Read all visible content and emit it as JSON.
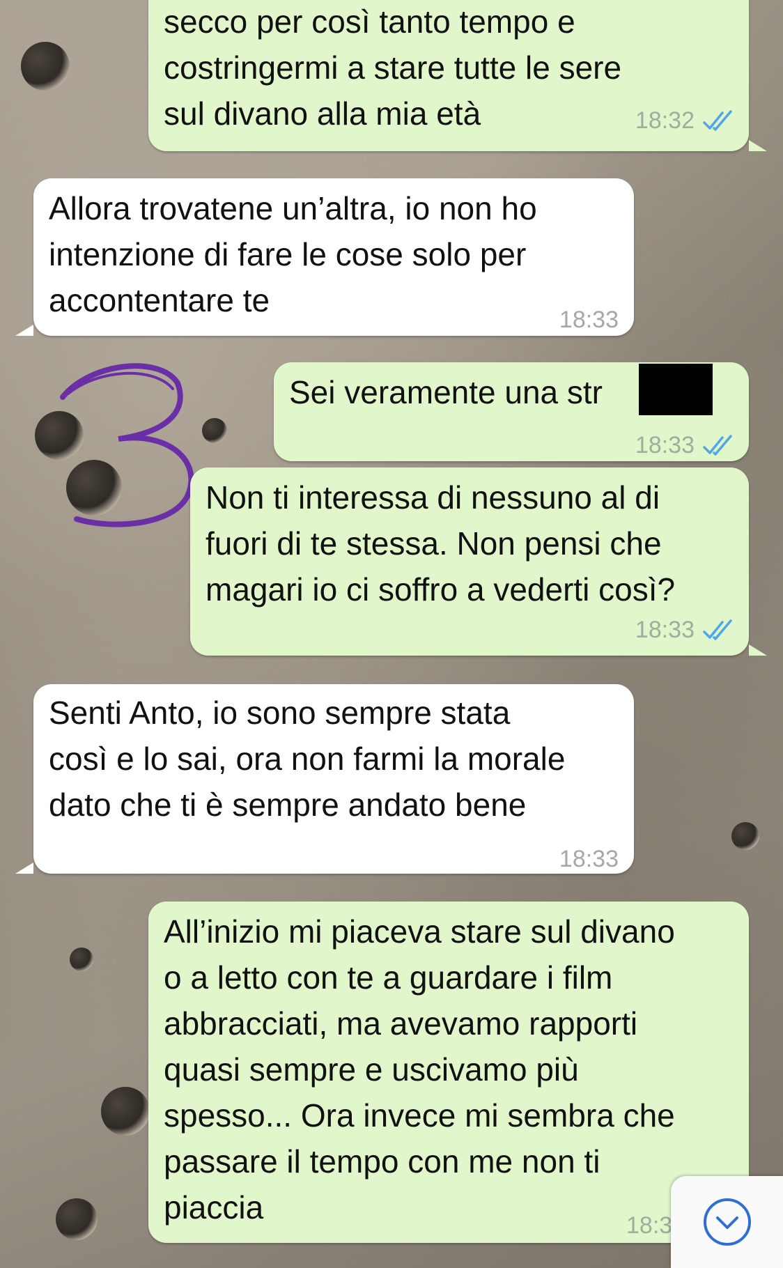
{
  "messages": [
    {
      "dir": "out",
      "text": "secco per così tanto tempo e\ncostringermi a stare tutte le sere\nsul divano alla mia età",
      "time": "18:32"
    },
    {
      "dir": "in",
      "text": "Allora trovatene un’altra, io non ho\nintenzione di fare le cose solo per\naccontentare te",
      "time": "18:33"
    },
    {
      "dir": "out",
      "text": "Sei veramente una str",
      "time": "18:33"
    },
    {
      "dir": "out",
      "text": "Non ti interessa di nessuno al di\nfuori di te stessa. Non pensi che\nmagari io ci soffro a vederti così?",
      "time": "18:33"
    },
    {
      "dir": "in",
      "text": "Senti Anto, io sono sempre stata\ncosì e lo sai, ora non farmi la morale\ndato che ti è sempre andato bene",
      "time": "18:33"
    },
    {
      "dir": "out",
      "text": "All’inizio mi piaceva stare sul divano\no a letto con te a guardare i film\nabbracciati, ma avevamo rapporti\nquasi sempre e uscivamo più\nspesso... Ora invece mi sembra che\npassare il tempo con me non ti\npiaccia",
      "time": "18:3"
    }
  ],
  "annotation": {
    "label": "3",
    "color": "#6a2fa6"
  },
  "icons": {
    "read_ticks": "double-check-icon",
    "scroll_down": "chevron-down-circle-icon"
  },
  "colors": {
    "out_bubble": "#e1f7cb",
    "in_bubble": "#ffffff",
    "ticks": "#4fa6e8",
    "scroll_icon": "#2f6fd1"
  }
}
